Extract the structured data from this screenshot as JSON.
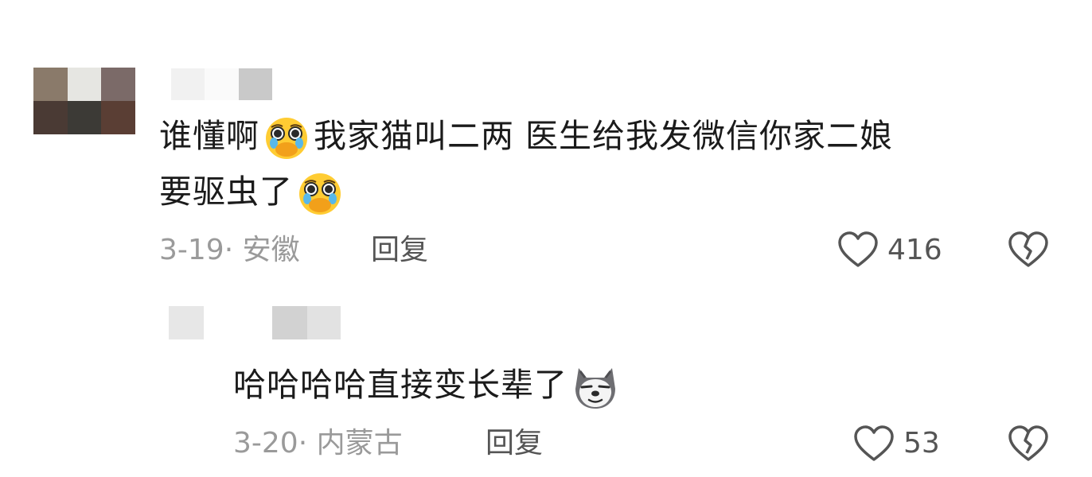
{
  "comments": [
    {
      "text_line1": "谁懂啊",
      "text_line1b": "我家猫叫二两 医生给我发微信你家二娘",
      "text_line2": "要驱虫了",
      "date": "3-19",
      "sep": "·",
      "location": "安徽",
      "reply_label": "回复",
      "like_count": "416"
    },
    {
      "text": "哈哈哈哈直接变长辈了",
      "date": "3-20",
      "sep": "·",
      "location": "内蒙古",
      "reply_label": "回复",
      "like_count": "53"
    }
  ],
  "icons": {
    "emoji_crying": "pleading-face-emoji",
    "emoji_dog": "doge-emoji",
    "like": "heart-outline-icon",
    "dislike": "broken-heart-icon"
  },
  "colors": {
    "text": "#1b1b1b",
    "meta": "#9a9a9a",
    "emoji_yellow": "#ffcc33"
  }
}
